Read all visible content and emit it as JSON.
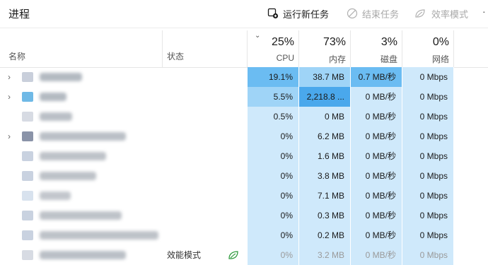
{
  "toolbar": {
    "title": "进程",
    "run_new_task": "运行新任务",
    "end_task": "结束任务",
    "efficiency_mode": "效率模式",
    "more": "·"
  },
  "header": {
    "name": "名称",
    "status": "状态",
    "cpu_pct": "25%",
    "cpu_label": "CPU",
    "mem_pct": "73%",
    "mem_label": "内存",
    "disk_pct": "3%",
    "disk_label": "磁盘",
    "net_pct": "0%",
    "net_label": "网络"
  },
  "rows": [
    {
      "expandable": true,
      "status": "",
      "cpu": "19.1%",
      "mem": "38.7 MB",
      "disk": "0.7 MB/秒",
      "net": "0 Mbps"
    },
    {
      "expandable": true,
      "status": "",
      "cpu": "5.5%",
      "mem": "2,218.8 ...",
      "disk": "0 MB/秒",
      "net": "0 Mbps"
    },
    {
      "expandable": false,
      "status": "",
      "cpu": "0.5%",
      "mem": "0 MB",
      "disk": "0 MB/秒",
      "net": "0 Mbps"
    },
    {
      "expandable": true,
      "status": "",
      "cpu": "0%",
      "mem": "6.2 MB",
      "disk": "0 MB/秒",
      "net": "0 Mbps"
    },
    {
      "expandable": false,
      "status": "",
      "cpu": "0%",
      "mem": "1.6 MB",
      "disk": "0 MB/秒",
      "net": "0 Mbps"
    },
    {
      "expandable": false,
      "status": "",
      "cpu": "0%",
      "mem": "3.8 MB",
      "disk": "0 MB/秒",
      "net": "0 Mbps"
    },
    {
      "expandable": false,
      "status": "",
      "cpu": "0%",
      "mem": "7.1 MB",
      "disk": "0 MB/秒",
      "net": "0 Mbps"
    },
    {
      "expandable": false,
      "status": "",
      "cpu": "0%",
      "mem": "0.3 MB",
      "disk": "0 MB/秒",
      "net": "0 Mbps"
    },
    {
      "expandable": false,
      "status": "",
      "cpu": "0%",
      "mem": "0.2 MB",
      "disk": "0 MB/秒",
      "net": "0 Mbps"
    },
    {
      "expandable": false,
      "status": "效能模式",
      "cpu": "0%",
      "mem": "3.2 MB",
      "disk": "0 MB/秒",
      "net": "0 Mbps"
    }
  ],
  "colors": {
    "heat_low": "#cfe9fb",
    "heat_mid": "#9fd4f7",
    "heat_high": "#6bbcf2",
    "heat_max": "#4aa8ec",
    "efficiency_leaf": "#2e9a3c"
  },
  "icons": {
    "run_new_task": "new-task-icon",
    "end_task": "end-task-icon",
    "efficiency_mode": "efficiency-leaf-icon",
    "expander": "chevron-right-icon",
    "sort": "chevron-down-icon"
  }
}
